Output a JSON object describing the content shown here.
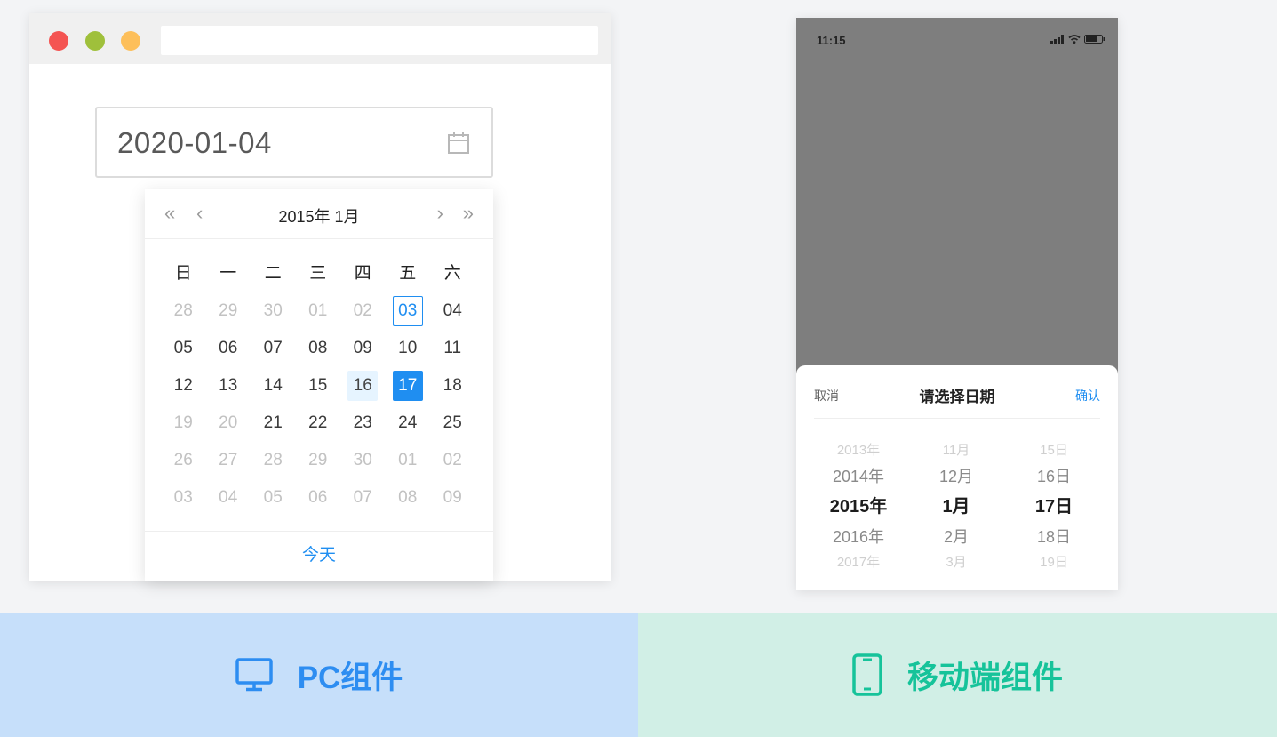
{
  "pc": {
    "input_value": "2020-01-04",
    "calendar": {
      "nav": {
        "prev_year": "«",
        "prev_month": "‹",
        "next_month": "›",
        "next_year": "»"
      },
      "title": "2015年 1月",
      "weekdays": [
        "日",
        "一",
        "二",
        "三",
        "四",
        "五",
        "六"
      ],
      "weeks": [
        [
          "28",
          "29",
          "30",
          "01",
          "02",
          "03",
          "04"
        ],
        [
          "05",
          "06",
          "07",
          "08",
          "09",
          "10",
          "11"
        ],
        [
          "12",
          "13",
          "14",
          "15",
          "16",
          "17",
          "18"
        ],
        [
          "19",
          "20",
          "21",
          "22",
          "23",
          "24",
          "25"
        ],
        [
          "26",
          "27",
          "28",
          "29",
          "30",
          "01",
          "02"
        ],
        [
          "03",
          "04",
          "05",
          "06",
          "07",
          "08",
          "09"
        ]
      ],
      "today_button": "今天"
    }
  },
  "mobile": {
    "status_time": "11:15",
    "picker": {
      "cancel": "取消",
      "title": "请选择日期",
      "confirm": "确认",
      "years": [
        "2013年",
        "2014年",
        "2015年",
        "2016年",
        "2017年"
      ],
      "months": [
        "11月",
        "12月",
        "1月",
        "2月",
        "3月"
      ],
      "days": [
        "15日",
        "16日",
        "17日",
        "18日",
        "19日"
      ]
    }
  },
  "labels": {
    "pc": "PC组件",
    "mobile": "移动端组件"
  },
  "colors": {
    "accent_blue": "#1f8ef1",
    "accent_green": "#16c39a"
  },
  "icons": {
    "calendar": "calendar-icon",
    "monitor": "monitor-icon",
    "phone": "phone-icon",
    "signal": "signal-icon",
    "wifi": "wifi-icon",
    "battery": "battery-icon"
  }
}
